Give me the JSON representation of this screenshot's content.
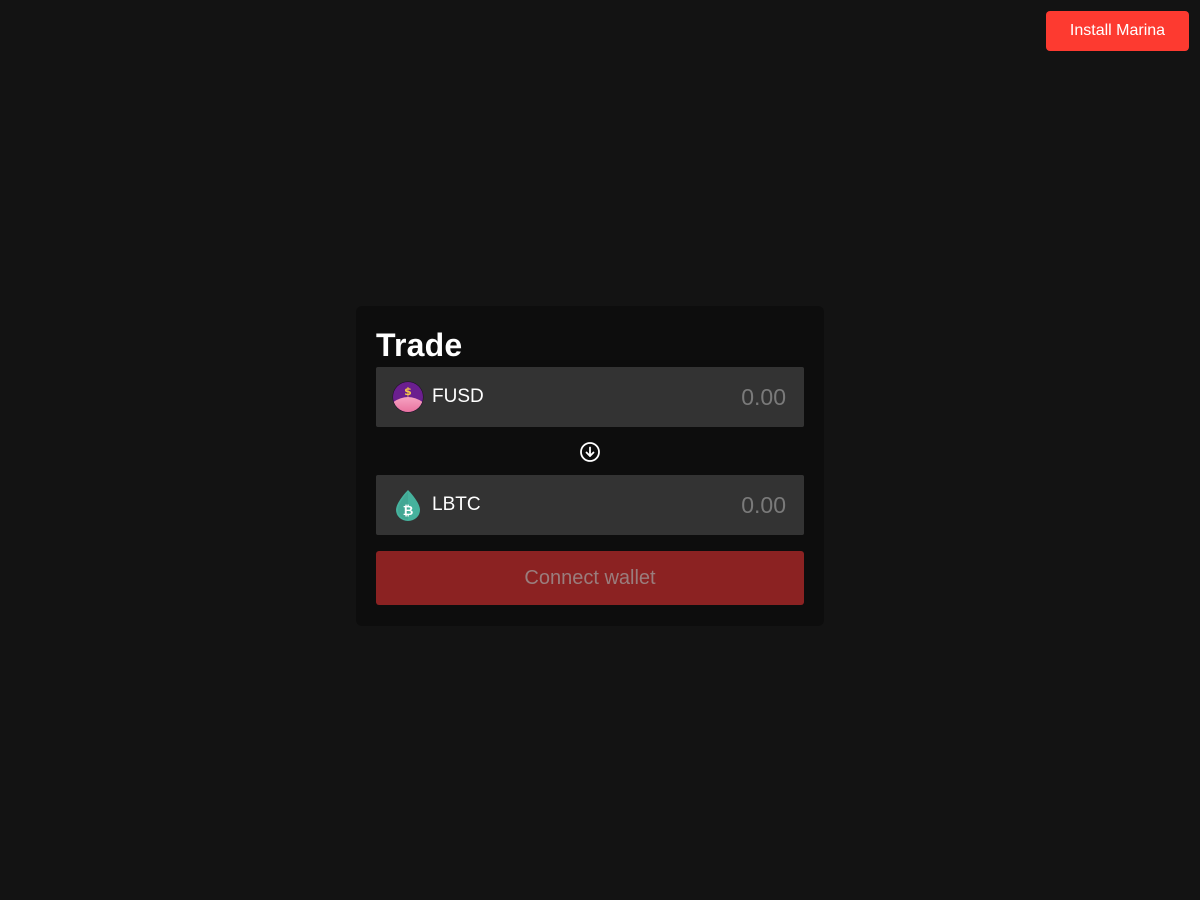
{
  "header": {
    "install_label": "Install Marina"
  },
  "trade": {
    "title": "Trade",
    "from": {
      "asset": "FUSD",
      "icon": "fusd-token-icon",
      "placeholder": "0.00"
    },
    "swap_icon": "arrow-down-circle-icon",
    "to": {
      "asset": "LBTC",
      "icon": "lbtc-token-icon",
      "placeholder": "0.00"
    },
    "connect_label": "Connect wallet"
  },
  "colors": {
    "background": "#131313",
    "card": "#0d0d0d",
    "row": "#333333",
    "accent": "#fd3a30",
    "connect_disabled": "#8b2222"
  }
}
